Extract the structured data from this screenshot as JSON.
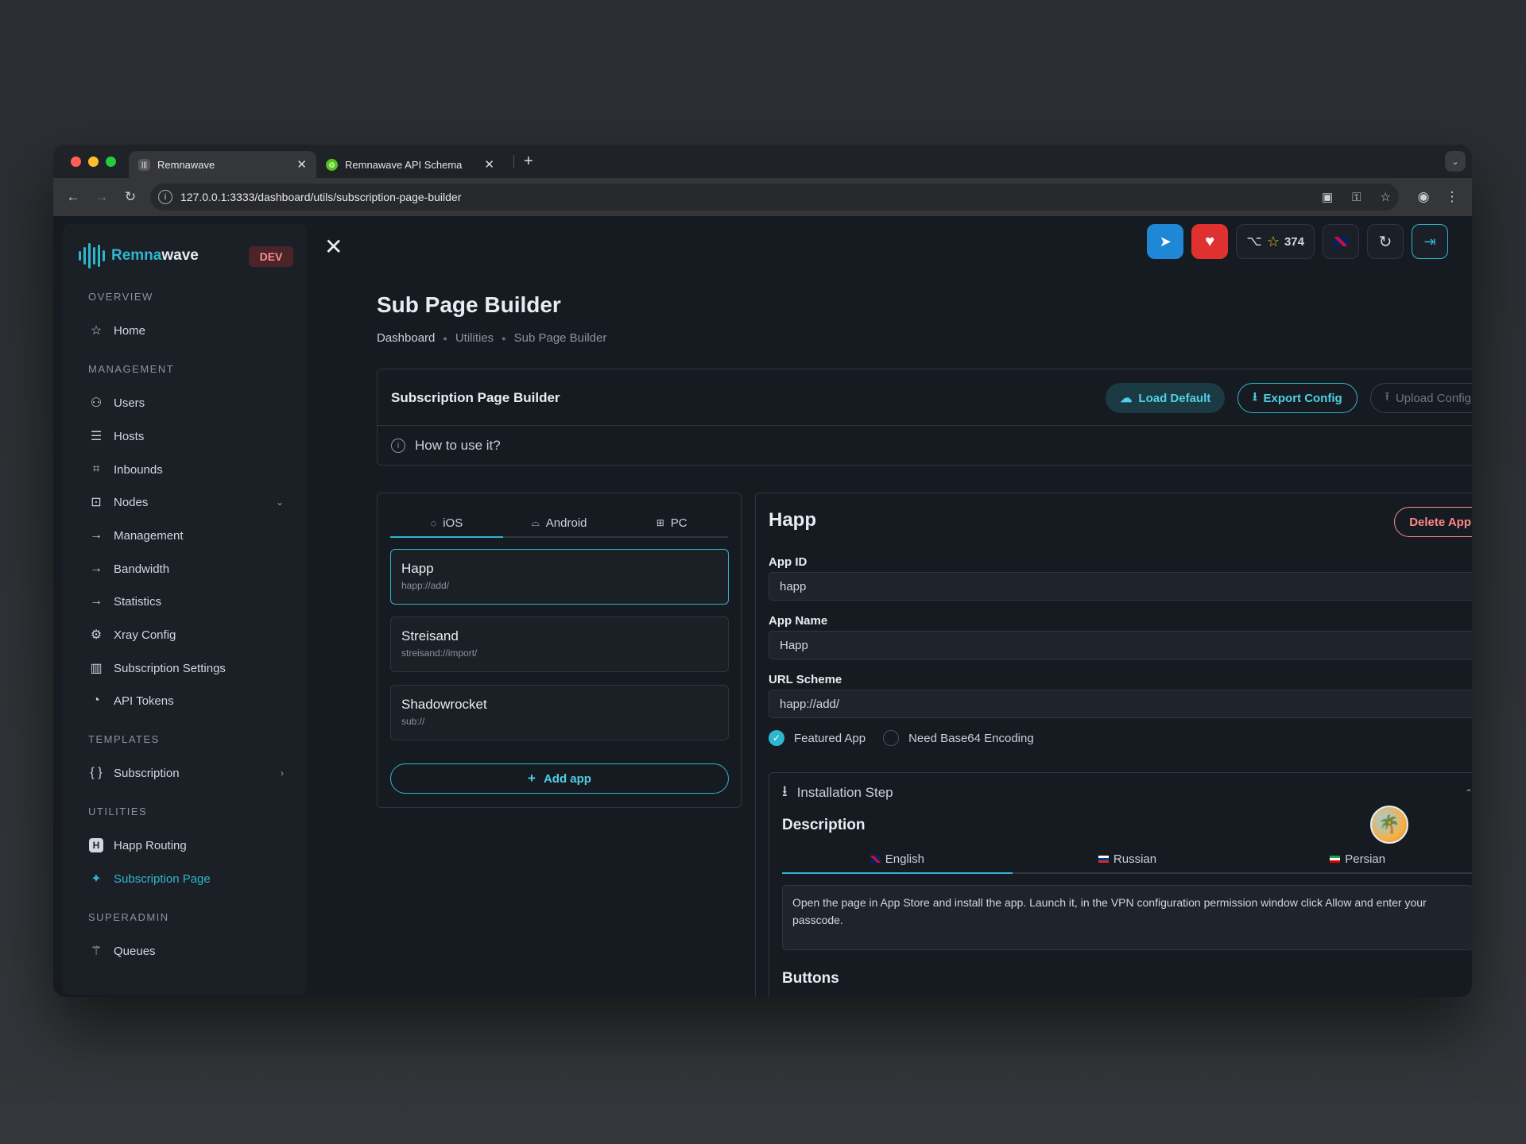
{
  "browser": {
    "tabs": [
      {
        "title": "Remnawave",
        "favicon": "remnawave-icon",
        "active": true
      },
      {
        "title": "Remnawave API Schema",
        "favicon": "globe-icon",
        "active": false
      }
    ],
    "url": "127.0.0.1:3333/dashboard/utils/subscription-page-builder"
  },
  "sidebar": {
    "logo_prefix": "Remna",
    "logo_suffix": "wave",
    "env_badge": "DEV",
    "sections": {
      "overview": "OVERVIEW",
      "management": "MANAGEMENT",
      "templates": "TEMPLATES",
      "utilities": "UTILITIES",
      "superadmin": "SUPERADMIN"
    },
    "items": {
      "home": "Home",
      "users": "Users",
      "hosts": "Hosts",
      "inbounds": "Inbounds",
      "nodes": "Nodes",
      "nodes_management": "Management",
      "nodes_bandwidth": "Bandwidth",
      "nodes_statistics": "Statistics",
      "xray_config": "Xray Config",
      "subscription_settings": "Subscription Settings",
      "api_tokens": "API Tokens",
      "subscription_template": "Subscription",
      "happ_routing": "Happ Routing",
      "subscription_page": "Subscription Page",
      "queues": "Queues"
    }
  },
  "header": {
    "github_stars": "374"
  },
  "page": {
    "title": "Sub Page Builder",
    "breadcrumbs": [
      "Dashboard",
      "Utilities",
      "Sub Page Builder"
    ]
  },
  "builder": {
    "title": "Subscription Page Builder",
    "load_default": "Load Default",
    "export_config": "Export Config",
    "upload_config": "Upload Config",
    "how_to": "How to use it?"
  },
  "platforms": {
    "tabs": [
      "iOS",
      "Android",
      "PC"
    ],
    "active": "iOS",
    "apps": [
      {
        "name": "Happ",
        "scheme": "happ://add/",
        "selected": true
      },
      {
        "name": "Streisand",
        "scheme": "streisand://import/",
        "selected": false
      },
      {
        "name": "Shadowrocket",
        "scheme": "sub://",
        "selected": false
      }
    ],
    "add_app": "Add app"
  },
  "editor": {
    "app_title": "Happ",
    "delete_app": "Delete App",
    "app_id_label": "App ID",
    "app_id_value": "happ",
    "app_name_label": "App Name",
    "app_name_value": "Happ",
    "url_scheme_label": "URL Scheme",
    "url_scheme_value": "happ://add/",
    "featured_label": "Featured App",
    "featured_checked": true,
    "base64_label": "Need Base64 Encoding",
    "base64_checked": false,
    "installation_step": "Installation Step",
    "description_heading": "Description",
    "lang_tabs": [
      "English",
      "Russian",
      "Persian"
    ],
    "description_text": "Open the page in App Store and install the app. Launch it, in the VPN configuration permission window click Allow and enter your passcode.",
    "buttons_heading": "Buttons"
  },
  "colors": {
    "accent": "#2fb6cf",
    "telegram": "#1e88d6",
    "heart": "#e03131",
    "danger_text": "#ff8787"
  }
}
